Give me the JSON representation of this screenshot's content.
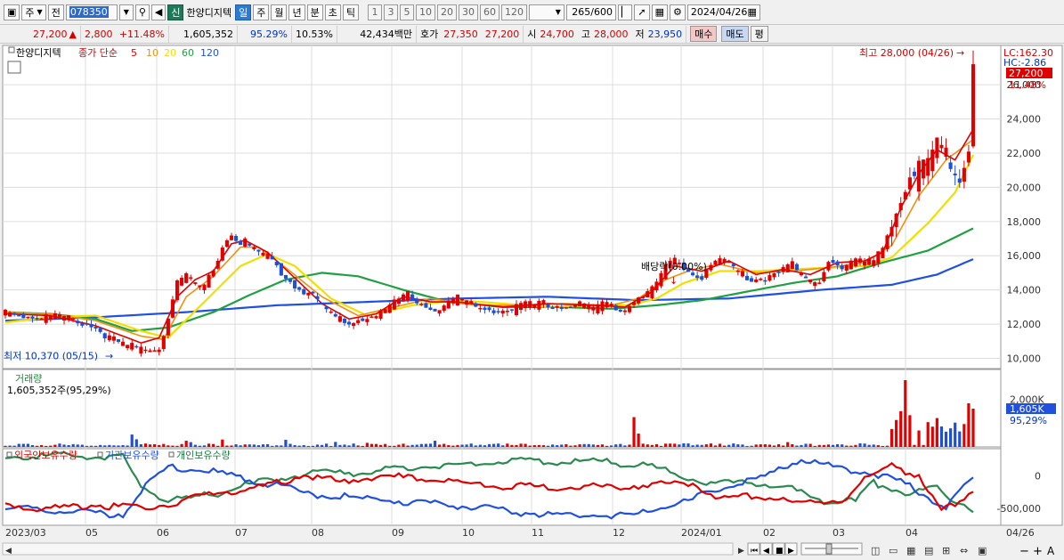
{
  "toolbar": {
    "type_sel": "주",
    "prev_label": "전",
    "code": "078350",
    "badge_new": "신",
    "stock_name": "한양디지텍",
    "periods": [
      "일",
      "주",
      "월",
      "년",
      "분",
      "초",
      "틱"
    ],
    "active_period": "일",
    "nums": [
      "1",
      "3",
      "5",
      "10",
      "20",
      "30",
      "60",
      "120"
    ],
    "count": "265",
    "count_total": "/600",
    "date": "2024/04/26"
  },
  "info": {
    "price": "27,200",
    "change": "2,800",
    "change_pct": "+11.48%",
    "volume": "1,605,352",
    "vol_ratio": "95.29%",
    "turnover": "10.53%",
    "amount": "42,434백만",
    "ask_label": "호가",
    "ask": "27,350",
    "bid": "27,200",
    "open_label": "시",
    "open": "24,700",
    "high_label": "고",
    "high": "28,000",
    "low_label": "저",
    "low": "23,950",
    "buy_btn": "매수",
    "sell_btn": "매도",
    "eval_btn": "평"
  },
  "colors": {
    "up": "#e00000",
    "down": "#1f4fd6",
    "ma5": "#e00000",
    "ma10": "#f09010",
    "ma20": "#f0e000",
    "ma60": "#20a040",
    "ma120": "#2050e0",
    "foreign": "#e00000",
    "inst": "#2050e0",
    "indiv": "#2a8a50"
  },
  "chart_data": [
    {
      "type": "line",
      "title": "한양디지텍",
      "legend": [
        "종가 단순",
        "5",
        "10",
        "20",
        "60",
        "120"
      ],
      "x_ticks": [
        "2023/03",
        "05",
        "06",
        "07",
        "08",
        "09",
        "10",
        "11",
        "12",
        "2024/01",
        "02",
        "03",
        "04",
        "04/26"
      ],
      "y_ticks": [
        10000,
        12000,
        14000,
        16000,
        18000,
        20000,
        22000,
        24000,
        26000
      ],
      "ylim": [
        9400,
        28300
      ],
      "label_lc": "LC:162.30",
      "label_hc": "HC:-2.86",
      "last_price": "27,200",
      "last_pct": "11.48%",
      "annotations": {
        "high": "최고 28,000 (04/26)",
        "low": "최저 10,370 (05/15)",
        "ex_div": "배당락(0.00%)"
      },
      "close_points": [
        [
          0,
          12900
        ],
        [
          6,
          12500
        ],
        [
          11,
          12600
        ],
        [
          16,
          12300
        ],
        [
          20,
          11900
        ],
        [
          23,
          11300
        ],
        [
          26,
          10900
        ],
        [
          30,
          10700
        ],
        [
          34,
          10700
        ],
        [
          36,
          12500
        ],
        [
          38,
          14600
        ],
        [
          40,
          14900
        ],
        [
          42,
          14400
        ],
        [
          44,
          14300
        ],
        [
          46,
          15300
        ],
        [
          48,
          16700
        ],
        [
          50,
          17300
        ],
        [
          52,
          16900
        ],
        [
          53,
          17000
        ],
        [
          55,
          16400
        ],
        [
          58,
          16100
        ],
        [
          62,
          14800
        ],
        [
          65,
          14200
        ],
        [
          68,
          13800
        ],
        [
          71,
          12900
        ],
        [
          74,
          12400
        ],
        [
          77,
          12200
        ],
        [
          80,
          12600
        ],
        [
          84,
          12800
        ],
        [
          86,
          13400
        ],
        [
          89,
          13900
        ],
        [
          92,
          13300
        ],
        [
          95,
          12900
        ],
        [
          100,
          13700
        ],
        [
          104,
          13100
        ],
        [
          110,
          12900
        ],
        [
          114,
          13200
        ],
        [
          119,
          13300
        ],
        [
          123,
          13100
        ],
        [
          127,
          13300
        ],
        [
          130,
          13100
        ],
        [
          133,
          13300
        ],
        [
          137,
          13000
        ],
        [
          140,
          13800
        ],
        [
          143,
          14100
        ],
        [
          146,
          15500
        ],
        [
          148,
          15900
        ],
        [
          151,
          15200
        ],
        [
          154,
          14900
        ],
        [
          156,
          15700
        ],
        [
          159,
          15900
        ],
        [
          162,
          15200
        ],
        [
          165,
          14700
        ],
        [
          168,
          14800
        ],
        [
          171,
          15300
        ],
        [
          174,
          15600
        ],
        [
          177,
          14600
        ],
        [
          180,
          14700
        ],
        [
          182,
          15900
        ],
        [
          185,
          15500
        ],
        [
          188,
          15800
        ],
        [
          192,
          15700
        ],
        [
          194,
          16600
        ],
        [
          197,
          18800
        ],
        [
          200,
          21000
        ],
        [
          203,
          21500
        ],
        [
          206,
          22700
        ],
        [
          209,
          21800
        ],
        [
          211,
          21000
        ],
        [
          213,
          22700
        ],
        [
          214,
          27200
        ]
      ],
      "ma5_points": [
        [
          0,
          12600
        ],
        [
          10,
          12500
        ],
        [
          20,
          11900
        ],
        [
          30,
          10900
        ],
        [
          34,
          11200
        ],
        [
          38,
          13600
        ],
        [
          42,
          14600
        ],
        [
          46,
          15100
        ],
        [
          50,
          16700
        ],
        [
          53,
          16900
        ],
        [
          58,
          16200
        ],
        [
          64,
          14700
        ],
        [
          70,
          13200
        ],
        [
          76,
          12300
        ],
        [
          82,
          12600
        ],
        [
          88,
          13600
        ],
        [
          94,
          13300
        ],
        [
          100,
          13300
        ],
        [
          110,
          13000
        ],
        [
          120,
          13200
        ],
        [
          130,
          13100
        ],
        [
          137,
          13000
        ],
        [
          143,
          13900
        ],
        [
          148,
          15400
        ],
        [
          154,
          15100
        ],
        [
          160,
          15700
        ],
        [
          166,
          14900
        ],
        [
          172,
          15200
        ],
        [
          178,
          14900
        ],
        [
          184,
          15600
        ],
        [
          190,
          15700
        ],
        [
          194,
          16200
        ],
        [
          198,
          18800
        ],
        [
          202,
          20800
        ],
        [
          206,
          22200
        ],
        [
          210,
          21600
        ],
        [
          214,
          23400
        ]
      ],
      "ma10_points": [
        [
          0,
          12700
        ],
        [
          10,
          12600
        ],
        [
          20,
          12200
        ],
        [
          30,
          11300
        ],
        [
          35,
          11100
        ],
        [
          40,
          13600
        ],
        [
          46,
          14800
        ],
        [
          52,
          16500
        ],
        [
          56,
          16500
        ],
        [
          62,
          15300
        ],
        [
          70,
          13600
        ],
        [
          78,
          12500
        ],
        [
          86,
          13000
        ],
        [
          94,
          13500
        ],
        [
          104,
          13100
        ],
        [
          114,
          13100
        ],
        [
          124,
          13200
        ],
        [
          134,
          13100
        ],
        [
          140,
          13500
        ],
        [
          146,
          14600
        ],
        [
          152,
          15200
        ],
        [
          158,
          15500
        ],
        [
          166,
          15000
        ],
        [
          174,
          15100
        ],
        [
          182,
          15300
        ],
        [
          190,
          15600
        ],
        [
          196,
          16600
        ],
        [
          202,
          19500
        ],
        [
          208,
          21600
        ],
        [
          214,
          22800
        ]
      ],
      "ma20_points": [
        [
          0,
          12100
        ],
        [
          10,
          12400
        ],
        [
          20,
          12500
        ],
        [
          30,
          11600
        ],
        [
          36,
          11200
        ],
        [
          44,
          13300
        ],
        [
          52,
          15400
        ],
        [
          58,
          16100
        ],
        [
          64,
          15400
        ],
        [
          72,
          13500
        ],
        [
          80,
          12500
        ],
        [
          90,
          13100
        ],
        [
          100,
          13400
        ],
        [
          110,
          13200
        ],
        [
          120,
          13000
        ],
        [
          130,
          13100
        ],
        [
          138,
          13100
        ],
        [
          144,
          13500
        ],
        [
          150,
          14400
        ],
        [
          158,
          15100
        ],
        [
          166,
          15100
        ],
        [
          174,
          15200
        ],
        [
          182,
          15300
        ],
        [
          190,
          15400
        ],
        [
          196,
          15900
        ],
        [
          204,
          17900
        ],
        [
          210,
          19700
        ],
        [
          214,
          21900
        ]
      ],
      "ma60_points": [
        [
          0,
          12700
        ],
        [
          10,
          12600
        ],
        [
          20,
          12300
        ],
        [
          28,
          11600
        ],
        [
          36,
          11800
        ],
        [
          46,
          12700
        ],
        [
          54,
          13700
        ],
        [
          62,
          14600
        ],
        [
          70,
          15000
        ],
        [
          78,
          14800
        ],
        [
          88,
          14000
        ],
        [
          98,
          13300
        ],
        [
          110,
          13000
        ],
        [
          122,
          13000
        ],
        [
          134,
          12900
        ],
        [
          144,
          13100
        ],
        [
          154,
          13400
        ],
        [
          164,
          13900
        ],
        [
          174,
          14400
        ],
        [
          184,
          14800
        ],
        [
          194,
          15600
        ],
        [
          204,
          16300
        ],
        [
          214,
          17600
        ]
      ],
      "ma120_points": [
        [
          0,
          12200
        ],
        [
          20,
          12400
        ],
        [
          40,
          12700
        ],
        [
          60,
          13100
        ],
        [
          80,
          13300
        ],
        [
          100,
          13500
        ],
        [
          120,
          13600
        ],
        [
          140,
          13400
        ],
        [
          160,
          13500
        ],
        [
          180,
          14000
        ],
        [
          196,
          14300
        ],
        [
          206,
          14900
        ],
        [
          214,
          15800
        ]
      ]
    },
    {
      "type": "bar",
      "title": "거래량",
      "readout": "1,605,352주(95,29%)",
      "y_tick": "2,000K",
      "last_value": "1,605K",
      "last_pct": "95,29%",
      "ylim": [
        0,
        2800
      ],
      "spikes": [
        [
          28,
          520
        ],
        [
          29,
          320
        ],
        [
          40,
          260
        ],
        [
          41,
          200
        ],
        [
          48,
          310
        ],
        [
          62,
          300
        ],
        [
          73,
          210
        ],
        [
          80,
          170
        ],
        [
          95,
          260
        ],
        [
          139,
          1250
        ],
        [
          140,
          560
        ],
        [
          173,
          200
        ],
        [
          190,
          140
        ],
        [
          196,
          750
        ],
        [
          197,
          1130
        ],
        [
          198,
          1500
        ],
        [
          199,
          2800
        ],
        [
          200,
          1330
        ],
        [
          202,
          690
        ],
        [
          204,
          1040
        ],
        [
          205,
          850
        ],
        [
          206,
          1210
        ],
        [
          207,
          860
        ],
        [
          208,
          640
        ],
        [
          209,
          780
        ],
        [
          210,
          1020
        ],
        [
          211,
          650
        ],
        [
          212,
          960
        ],
        [
          213,
          1830
        ],
        [
          214,
          1605
        ]
      ]
    },
    {
      "type": "line",
      "legend": [
        "외국인보유수량",
        "기관보유수량",
        "개인보유수량"
      ],
      "y_ticks": [
        0,
        -500000
      ],
      "y_tick_labels": [
        "0",
        "-500,000"
      ],
      "ylim": [
        -760000,
        420000
      ],
      "foreign_points": [
        [
          0,
          -420000
        ],
        [
          10,
          -470000
        ],
        [
          20,
          -410000
        ],
        [
          28,
          -460000
        ],
        [
          36,
          -420000
        ],
        [
          46,
          -230000
        ],
        [
          56,
          -160000
        ],
        [
          62,
          -40000
        ],
        [
          66,
          40000
        ],
        [
          74,
          -60000
        ],
        [
          84,
          30000
        ],
        [
          96,
          -40000
        ],
        [
          110,
          -130000
        ],
        [
          124,
          -150000
        ],
        [
          140,
          -120000
        ],
        [
          152,
          -70000
        ],
        [
          158,
          -330000
        ],
        [
          166,
          -260000
        ],
        [
          176,
          -400000
        ],
        [
          186,
          -310000
        ],
        [
          190,
          -40000
        ],
        [
          196,
          230000
        ],
        [
          202,
          -10000
        ],
        [
          207,
          -520000
        ],
        [
          211,
          -330000
        ],
        [
          214,
          -190000
        ]
      ],
      "inst_points": [
        [
          0,
          -470000
        ],
        [
          14,
          -520000
        ],
        [
          26,
          -560000
        ],
        [
          30,
          -200000
        ],
        [
          36,
          160000
        ],
        [
          46,
          90000
        ],
        [
          56,
          -50000
        ],
        [
          66,
          -230000
        ],
        [
          80,
          -330000
        ],
        [
          96,
          -400000
        ],
        [
          112,
          -520000
        ],
        [
          124,
          -580000
        ],
        [
          140,
          -560000
        ],
        [
          152,
          -330000
        ],
        [
          158,
          -160000
        ],
        [
          166,
          -40000
        ],
        [
          176,
          290000
        ],
        [
          184,
          140000
        ],
        [
          190,
          120000
        ],
        [
          200,
          -120000
        ],
        [
          208,
          -470000
        ],
        [
          212,
          -130000
        ],
        [
          214,
          -10000
        ]
      ],
      "indiv_points": [
        [
          0,
          320000
        ],
        [
          14,
          350000
        ],
        [
          26,
          310000
        ],
        [
          30,
          -120000
        ],
        [
          36,
          -370000
        ],
        [
          46,
          -250000
        ],
        [
          56,
          -70000
        ],
        [
          66,
          60000
        ],
        [
          80,
          90000
        ],
        [
          96,
          200000
        ],
        [
          110,
          250000
        ],
        [
          124,
          260000
        ],
        [
          140,
          220000
        ],
        [
          152,
          -20000
        ],
        [
          158,
          -90000
        ],
        [
          166,
          -70000
        ],
        [
          174,
          -180000
        ],
        [
          182,
          -370000
        ],
        [
          188,
          -360000
        ],
        [
          192,
          -70000
        ],
        [
          200,
          -240000
        ],
        [
          206,
          -160000
        ],
        [
          210,
          -340000
        ],
        [
          214,
          -480000
        ]
      ]
    }
  ]
}
